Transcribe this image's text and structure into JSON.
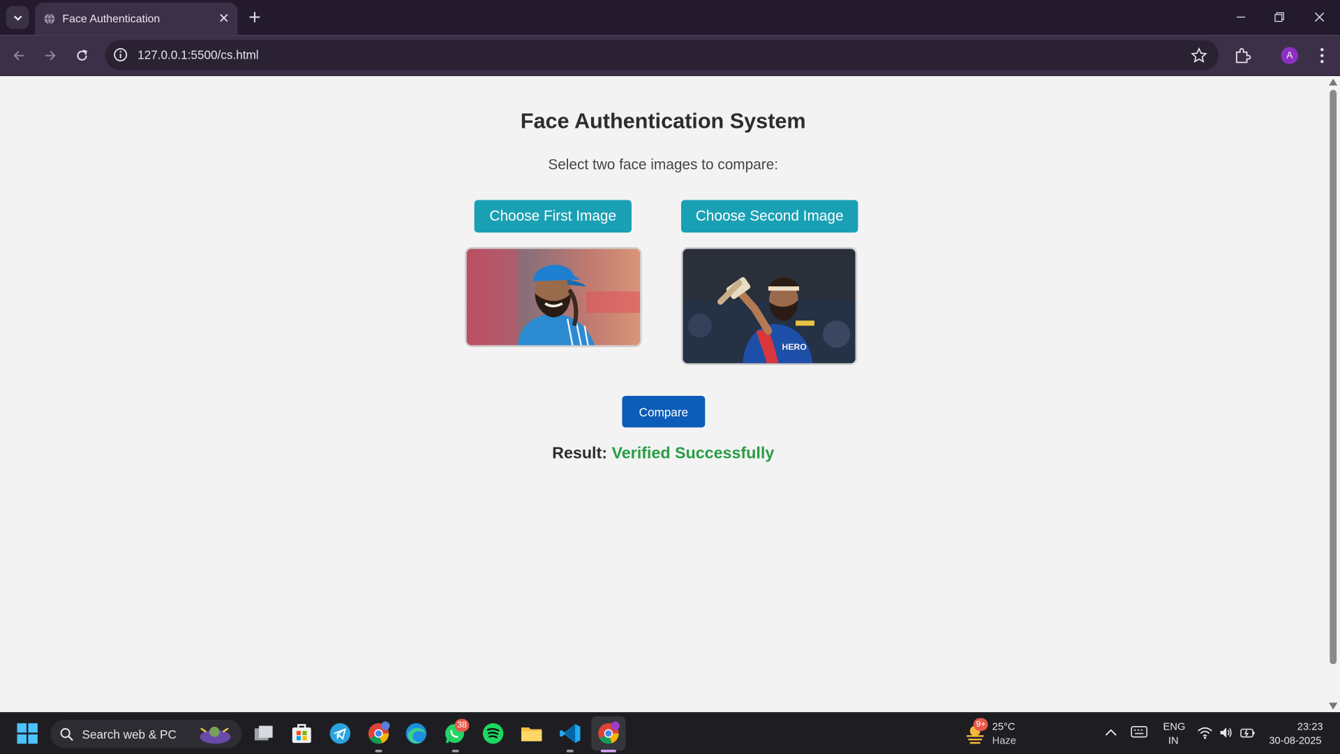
{
  "browser": {
    "tab_title": "Face Authentication",
    "url": "127.0.0.1:5500/cs.html",
    "profile_initial": "A"
  },
  "page": {
    "title": "Face Authentication System",
    "subtitle": "Select two face images to compare:",
    "first_button": "Choose First Image",
    "second_button": "Choose Second Image",
    "compare_button": "Compare",
    "result_label": "Result:",
    "result_value": "Verified Successfully"
  },
  "taskbar": {
    "search_placeholder": "Search web & PC",
    "whatsapp_badge": "38",
    "weather_badge": "9+",
    "temperature": "25°C",
    "weather": "Haze",
    "language": "ENG",
    "region": "IN",
    "time": "23:23",
    "date": "30-08-2025"
  },
  "colors": {
    "accent_button": "#1aa0b4",
    "compare_button": "#0b5db8",
    "success": "#2a9c45"
  }
}
